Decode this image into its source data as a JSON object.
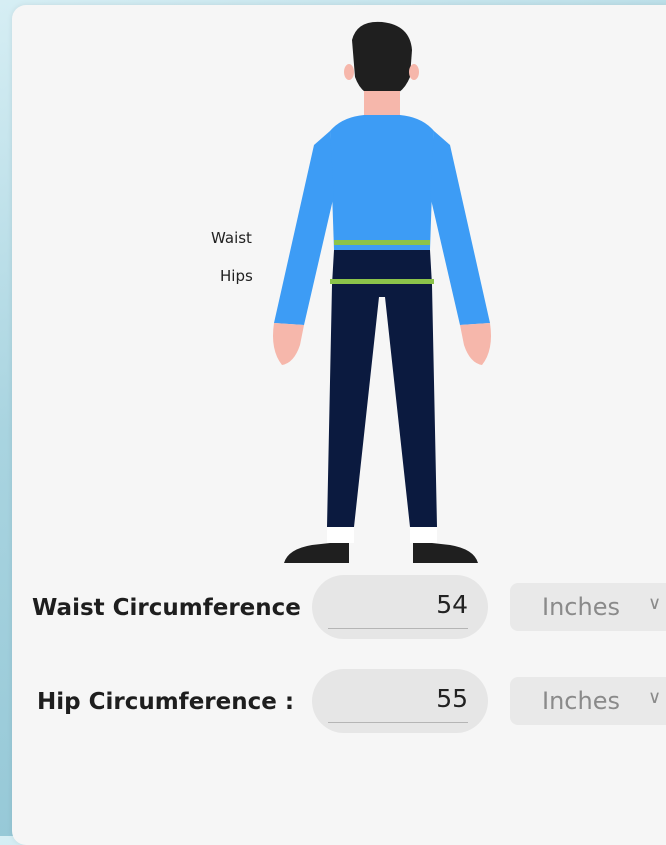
{
  "figure": {
    "waist_label": "Waist",
    "hips_label": "Hips"
  },
  "fields": {
    "waist": {
      "label": "Waist Circumference",
      "value": "54",
      "unit": "Inches"
    },
    "hip": {
      "label": "Hip Circumference :",
      "value": "55",
      "unit": "Inches"
    }
  },
  "colors": {
    "shirt": "#3d9cf5",
    "pants": "#0b1a3f",
    "skin": "#f6b7ab",
    "hair": "#1f1f1f",
    "measure_line": "#8bc34a"
  },
  "icons": {
    "dropdown": "chevron-down-icon"
  }
}
